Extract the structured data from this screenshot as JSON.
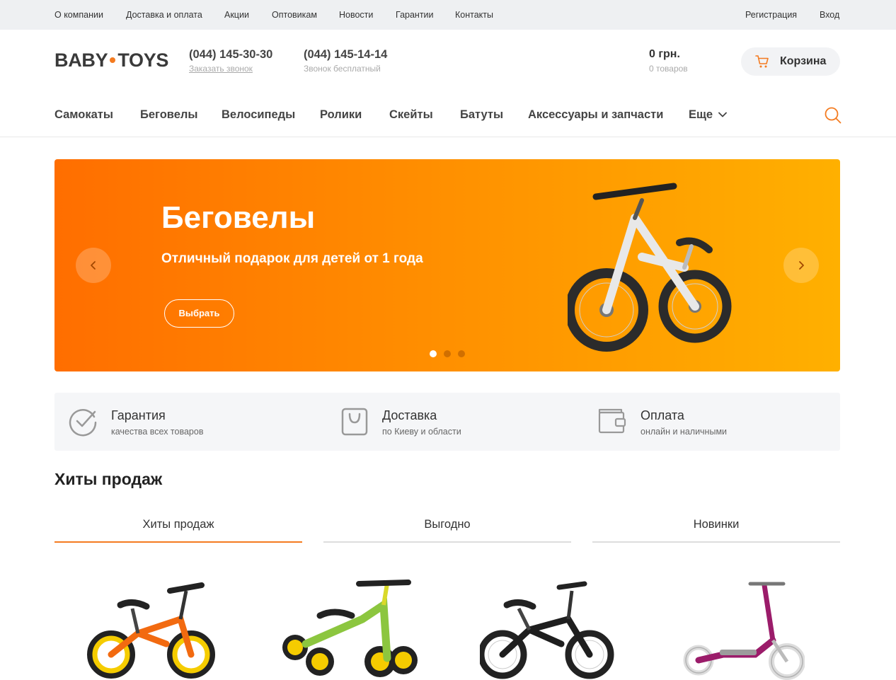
{
  "topbar": {
    "links": [
      "О компании",
      "Доставка и оплата",
      "Акции",
      "Оптовикам",
      "Новости",
      "Гарантии",
      "Контакты"
    ],
    "register": "Регистрация",
    "login": "Вход"
  },
  "header": {
    "logo_left": "BABY",
    "logo_right": "TOYS",
    "phone1": "(044) 145-30-30",
    "phone1_sub": "Заказать звонок",
    "phone2": "(044) 145-14-14",
    "phone2_sub": "Звонок бесплатный",
    "cart_total": "0 грн.",
    "cart_count": "0 товаров",
    "cart_label": "Корзина"
  },
  "nav": {
    "items": [
      "Самокаты",
      "Беговелы",
      "Велосипеды",
      "Ролики",
      "Скейты",
      "Батуты",
      "Аксессуары и запчасти",
      "Еще"
    ],
    "search_icon": "search-icon"
  },
  "banner": {
    "title": "Беговелы",
    "subtitle": "Отличный подарок для детей от 1 года",
    "button": "Выбрать",
    "slides": 3,
    "active_slide": 1
  },
  "features": [
    {
      "icon": "checkmark-circle-icon",
      "title": "Гарантия",
      "desc": "качества всех товаров"
    },
    {
      "icon": "bag-icon",
      "title": "Доставка",
      "desc": "по Киеву и области"
    },
    {
      "icon": "wallet-icon",
      "title": "Оплата",
      "desc": "онлайн и наличными"
    }
  ],
  "section": {
    "title": "Хиты продаж",
    "tabs": [
      "Хиты продаж",
      "Выгодно",
      "Новинки"
    ],
    "active_tab": 0
  },
  "colors": {
    "accent": "#f47b20",
    "banner_start": "#ff6e00",
    "banner_end": "#ffb000",
    "topbar_bg": "#eef0f2"
  }
}
